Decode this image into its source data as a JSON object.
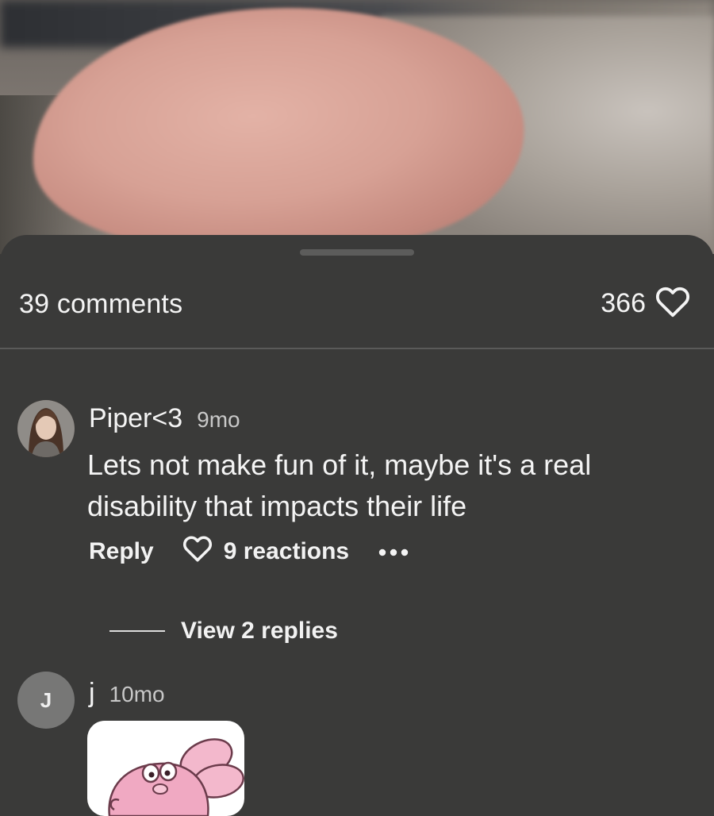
{
  "media": {
    "description_icon": "video-frame"
  },
  "comments_header": {
    "count_label": "39 comments",
    "likes_count": "366",
    "like_icon": "heart-outline-icon"
  },
  "comments": [
    {
      "username": "Piper<3",
      "time": "9mo",
      "avatar": "profile-photo",
      "text": "Lets not make fun of it, maybe it's a real disability that impacts their life",
      "reply_label": "Reply",
      "reactions_label": "9 reactions",
      "more_icon": "more-dots-icon",
      "view_replies_label": "View 2 replies"
    },
    {
      "username": "j",
      "time": "10mo",
      "avatar_letter": "J",
      "sticker": "pink-cartoon-sticker"
    }
  ],
  "colors": {
    "sheet_background": "#3a3a39",
    "text_primary": "#f4f4f4",
    "text_secondary": "#c8c8c8",
    "divider": "#5a5a59"
  }
}
